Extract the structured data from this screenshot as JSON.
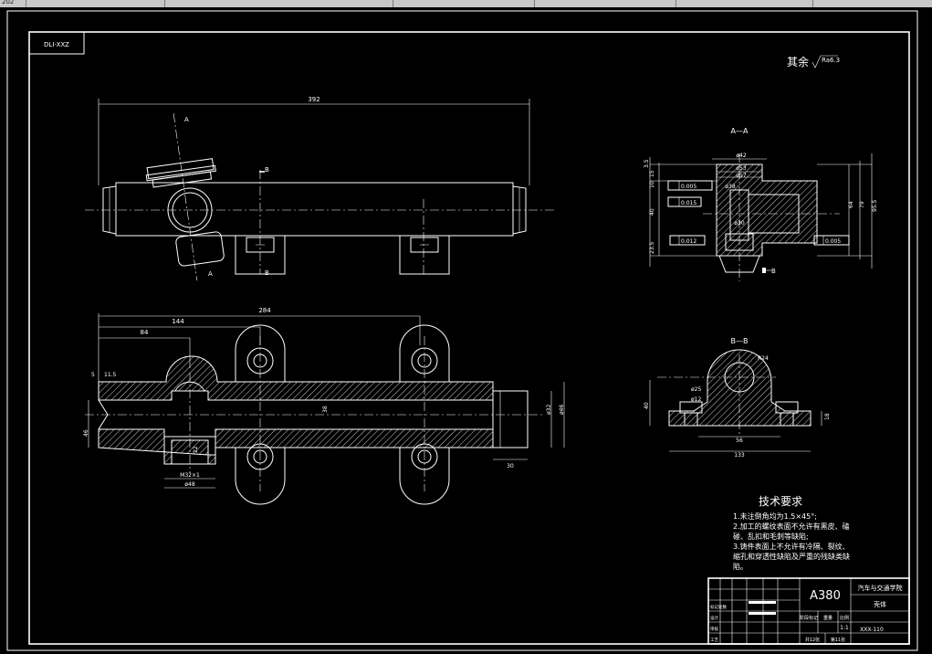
{
  "toolbar": {
    "left_text": "202"
  },
  "drawing": {
    "drawing_code": "DLI-XXZ",
    "surface_finish": {
      "label": "其余",
      "value": "Ra6.3"
    },
    "section_aa_label": "A—A",
    "section_bb_label": "B—B",
    "view_marks": {
      "a": "A",
      "b": "B"
    },
    "dims_top": {
      "overall": "392"
    },
    "dims_front": {
      "d284": "284",
      "d144": "144",
      "d84": "84",
      "d5": "5",
      "d11_5": "11.5",
      "d46": "46",
      "d32": "32",
      "d32b": "ø32",
      "d46b": "ø46",
      "d30": "30",
      "d22": "22",
      "d48": "ø48",
      "thread": "M32×1",
      "center": "38"
    },
    "dims_aa": {
      "d42": "ø42",
      "d53": "ø53",
      "d57": "ø57",
      "d38": "ø38",
      "d30": "ø30",
      "d3_5": "3.5",
      "d10": "10",
      "d15": "15",
      "d40": "40",
      "d23_5": "23.5",
      "d64": "64",
      "d79": "79",
      "d95_5": "95.5",
      "tol1": "0.005",
      "tol2": "0.015",
      "tol3": "0.012",
      "tol4": "0.005",
      "datum": "B"
    },
    "dims_bb": {
      "r24": "R24",
      "d25": "ø25",
      "d12": "ø12",
      "d40": "40",
      "d56": "56",
      "d133": "133",
      "d18": "18"
    }
  },
  "tech_requirements": {
    "title": "技术要求",
    "items": [
      "1.未注倒角均为1.5×45°;",
      "2.加工的螺纹表面不允许有黑皮、磕",
      "碰、乱扣和毛刺等缺陷;",
      "3.铸件表面上不允许有冷隔、裂纹、",
      "缩孔和穿透性缺陷及严重的残缺类缺",
      "陷。"
    ]
  },
  "title_block": {
    "material": "A380",
    "school": "汽车与交通学院",
    "part_name": "壳体",
    "drawing_no": "XXX-110",
    "scale": "1:1",
    "sheet_total": "共12张",
    "sheet_no": "第11张",
    "headers": [
      "阶段标记",
      "重量",
      "比例"
    ],
    "rows": [
      "标记处数",
      "设计",
      "审核",
      "工艺"
    ]
  }
}
